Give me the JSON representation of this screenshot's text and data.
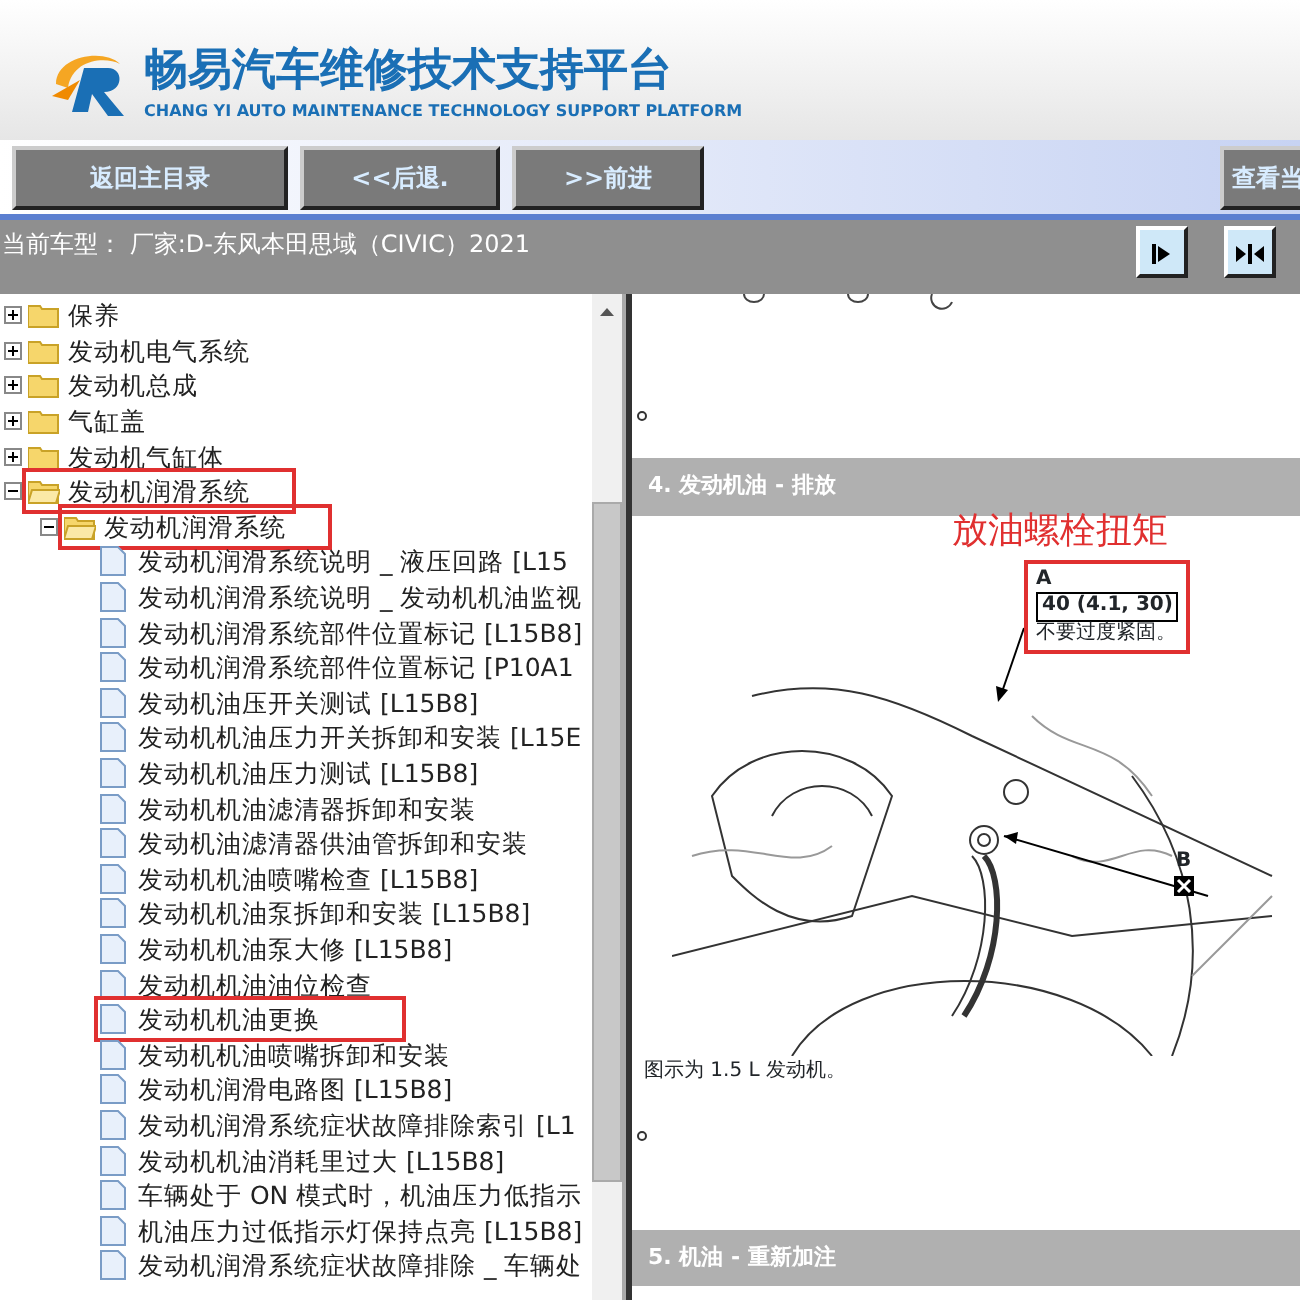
{
  "header": {
    "title": "畅易汽车维修技术支持平台",
    "subtitle": "CHANG YI AUTO MAINTENANCE TECHNOLOGY SUPPORT PLATFORM"
  },
  "toolbar": {
    "buttons": [
      "返回主目录",
      "<<后退.",
      ">>前进"
    ],
    "right_button": "查看当"
  },
  "vehicle_bar": {
    "text": "当前车型： 厂家:D-东风本田思域（CIVIC）2021"
  },
  "tree": [
    {
      "label": "保养",
      "kind": "folder",
      "expanded": false,
      "highlighted": false
    },
    {
      "label": "发动机电气系统",
      "kind": "folder",
      "expanded": false,
      "highlighted": false
    },
    {
      "label": "发动机总成",
      "kind": "folder",
      "expanded": false,
      "highlighted": false
    },
    {
      "label": "气缸盖",
      "kind": "folder",
      "expanded": false,
      "highlighted": false
    },
    {
      "label": "发动机气缸体",
      "kind": "folder",
      "expanded": false,
      "highlighted": false
    },
    {
      "label": "发动机润滑系统",
      "kind": "folder",
      "expanded": true,
      "highlighted": true,
      "children": [
        {
          "label": "发动机润滑系统",
          "kind": "folder",
          "expanded": true,
          "highlighted": true,
          "children": [
            {
              "label": "发动机润滑系统说明 _ 液压回路 [L15",
              "kind": "doc",
              "highlighted": false
            },
            {
              "label": "发动机润滑系统说明 _ 发动机机油监视",
              "kind": "doc",
              "highlighted": false
            },
            {
              "label": "发动机润滑系统部件位置标记 [L15B8]",
              "kind": "doc",
              "highlighted": false
            },
            {
              "label": "发动机润滑系统部件位置标记 [P10A1",
              "kind": "doc",
              "highlighted": false
            },
            {
              "label": "发动机油压开关测试 [L15B8]",
              "kind": "doc",
              "highlighted": false
            },
            {
              "label": "发动机机油压力开关拆卸和安装 [L15E",
              "kind": "doc",
              "highlighted": false
            },
            {
              "label": "发动机机油压力测试 [L15B8]",
              "kind": "doc",
              "highlighted": false
            },
            {
              "label": "发动机机油滤清器拆卸和安装",
              "kind": "doc",
              "highlighted": false
            },
            {
              "label": "发动机油滤清器供油管拆卸和安装",
              "kind": "doc",
              "highlighted": false
            },
            {
              "label": "发动机机油喷嘴检查 [L15B8]",
              "kind": "doc",
              "highlighted": false
            },
            {
              "label": "发动机机油泵拆卸和安装 [L15B8]",
              "kind": "doc",
              "highlighted": false
            },
            {
              "label": "发动机机油泵大修 [L15B8]",
              "kind": "doc",
              "highlighted": false
            },
            {
              "label": "发动机机油油位检查",
              "kind": "doc",
              "highlighted": false
            },
            {
              "label": "发动机机油更换",
              "kind": "doc",
              "highlighted": true
            },
            {
              "label": "发动机机油喷嘴拆卸和安装",
              "kind": "doc",
              "highlighted": false
            },
            {
              "label": "发动机润滑电路图 [L15B8]",
              "kind": "doc",
              "highlighted": false
            },
            {
              "label": "发动机润滑系统症状故障排除索引 [L1",
              "kind": "doc",
              "highlighted": false
            },
            {
              "label": "发动机机油消耗里过大 [L15B8]",
              "kind": "doc",
              "highlighted": false
            },
            {
              "label": "车辆处于 ON 模式时，机油压力低指示",
              "kind": "doc",
              "highlighted": false
            },
            {
              "label": "机油压力过低指示灯保持点亮 [L15B8]",
              "kind": "doc",
              "highlighted": false
            },
            {
              "label": "发动机润滑系统症状故障排除 _ 车辆处",
              "kind": "doc",
              "highlighted": false
            }
          ]
        }
      ]
    }
  ],
  "content": {
    "section_title": "4. 发动机油 - 排放",
    "annotation": "放油螺栓扭矩",
    "callout": {
      "label": "A",
      "torque": "40 (4.1, 30)",
      "note": "不要过度紧固。"
    },
    "label_b": "B",
    "caption": "图示为 1.5 L 发动机。",
    "next_section_title": "5. 机油 - 重新加注"
  }
}
